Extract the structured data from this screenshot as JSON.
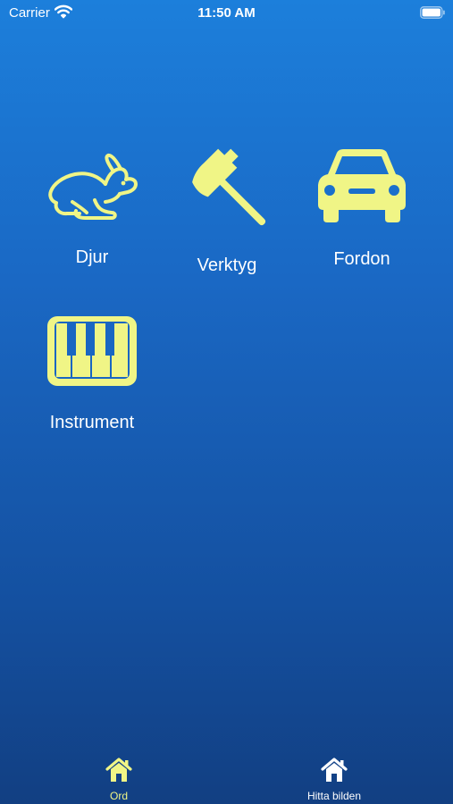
{
  "status": {
    "carrier": "Carrier",
    "time": "11:50 AM"
  },
  "colors": {
    "accent": "#f0f586",
    "text": "#ffffff",
    "background_top": "#1c7fdb",
    "background_bottom": "#123f82"
  },
  "categories": [
    {
      "label": "Djur",
      "icon": "rabbit-icon"
    },
    {
      "label": "Verktyg",
      "icon": "hammer-icon"
    },
    {
      "label": "Fordon",
      "icon": "car-icon"
    },
    {
      "label": "Instrument",
      "icon": "piano-icon"
    }
  ],
  "tabs": [
    {
      "label": "Ord",
      "icon": "home-icon",
      "selected": true
    },
    {
      "label": "Hitta bilden",
      "icon": "home-icon",
      "selected": false
    }
  ]
}
